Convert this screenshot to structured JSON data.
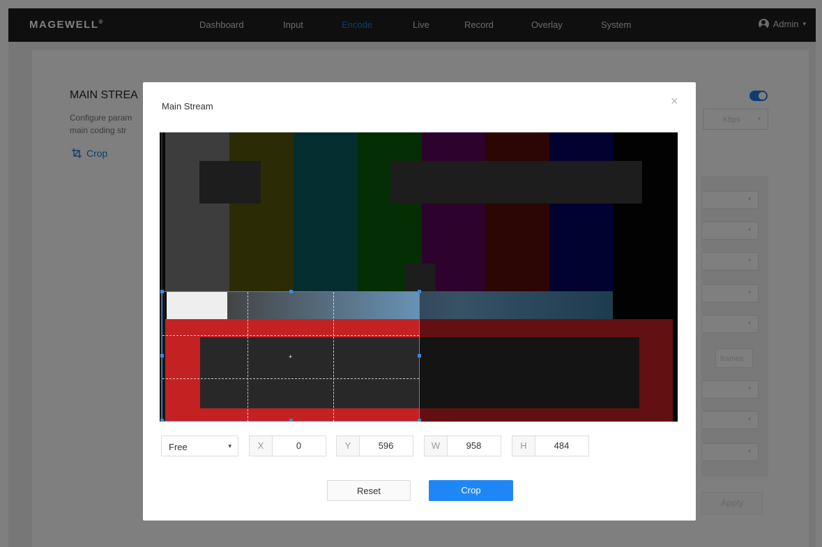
{
  "nav": {
    "logo": "MAGEWELL",
    "logo_mark": "®",
    "items": [
      {
        "label": "Dashboard",
        "active": false
      },
      {
        "label": "Input",
        "active": false
      },
      {
        "label": "Encode",
        "active": true
      },
      {
        "label": "Live",
        "active": false
      },
      {
        "label": "Record",
        "active": false
      },
      {
        "label": "Overlay",
        "active": false
      },
      {
        "label": "System",
        "active": false
      }
    ],
    "user": "Admin",
    "user_icon": "user-icon",
    "user_caret": "▾"
  },
  "page": {
    "title": "MAIN STREA",
    "desc_line1": "Configure param",
    "desc_line2": "main coding str",
    "crop_link": "Crop",
    "crop_icon": "crop-icon",
    "toggle_on": true,
    "unit": "Kbps",
    "frames_unit": "frames",
    "apply": "Apply",
    "dropdown_caret": "▾"
  },
  "modal": {
    "title": "Main Stream",
    "close": "×",
    "preview": {
      "bar_colors": [
        "#7a7a7a",
        "#56560b",
        "#0b5d60",
        "#085c09",
        "#5a0559",
        "#580a0b",
        "#050560",
        "#050505"
      ]
    },
    "ratio": {
      "value": "Free",
      "caret": "▾"
    },
    "fields": [
      {
        "label": "X",
        "value": "0"
      },
      {
        "label": "Y",
        "value": "596"
      },
      {
        "label": "W",
        "value": "958"
      },
      {
        "label": "H",
        "value": "484"
      }
    ],
    "buttons": {
      "reset": "Reset",
      "crop": "Crop"
    }
  },
  "colors": {
    "accent": "#1f87f5",
    "nav_bg": "#1e1e1e",
    "selection": "#3d8bd9"
  }
}
